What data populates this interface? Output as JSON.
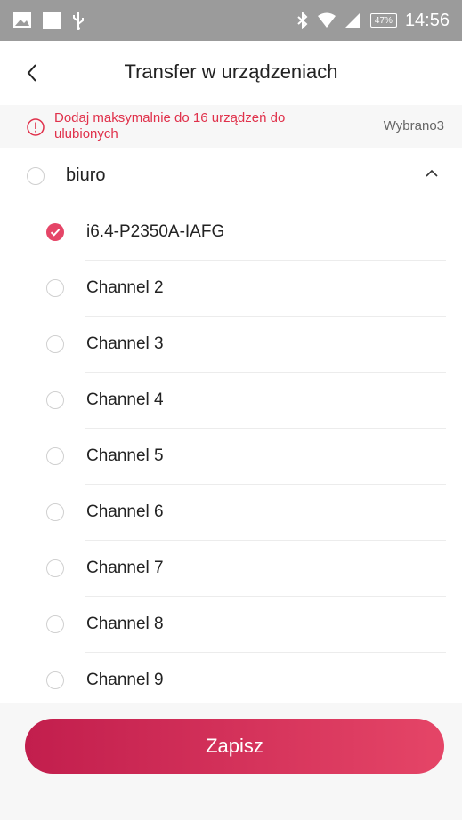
{
  "status_bar": {
    "time": "14:56",
    "battery": "47%",
    "icons": [
      "image-icon",
      "square-icon",
      "usb-icon",
      "bluetooth-icon",
      "wifi-icon",
      "signal-icon",
      "battery-icon"
    ]
  },
  "header": {
    "title": "Transfer w urządzeniach"
  },
  "notice": {
    "text": "Dodaj maksymalnie do 16 urządzeń do ulubionych",
    "count": "Wybrano3"
  },
  "group": {
    "label": "biuro",
    "expanded": true
  },
  "channels": [
    {
      "label": "i6.4-P2350A-IAFG",
      "checked": true
    },
    {
      "label": "Channel 2",
      "checked": false
    },
    {
      "label": "Channel 3",
      "checked": false
    },
    {
      "label": "Channel 4",
      "checked": false
    },
    {
      "label": "Channel 5",
      "checked": false
    },
    {
      "label": "Channel 6",
      "checked": false
    },
    {
      "label": "Channel 7",
      "checked": false
    },
    {
      "label": "Channel 8",
      "checked": false
    },
    {
      "label": "Channel 9",
      "checked": false
    }
  ],
  "save_label": "Zapisz",
  "colors": {
    "accent": "#e54567",
    "warning": "#e0314b",
    "status_bar": "#9b9b9b",
    "button_start": "#c21e4d",
    "button_end": "#e54567"
  }
}
